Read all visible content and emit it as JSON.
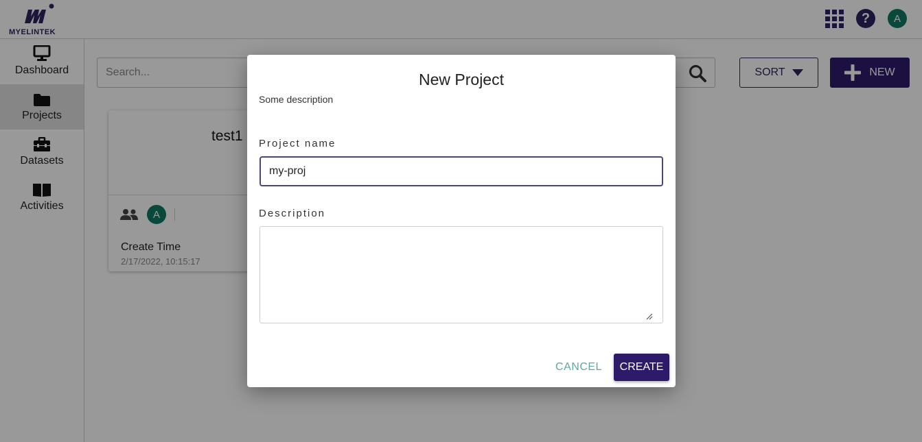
{
  "header": {
    "logo_text": "MYELINTEK",
    "avatar_initial": "A"
  },
  "sidebar": {
    "items": [
      {
        "label": "Dashboard",
        "icon": "monitor-icon"
      },
      {
        "label": "Projects",
        "icon": "folder-icon"
      },
      {
        "label": "Datasets",
        "icon": "toolbox-icon"
      },
      {
        "label": "Activities",
        "icon": "book-icon"
      }
    ]
  },
  "toolbar": {
    "search_placeholder": "Search...",
    "sort_label": "SORT",
    "new_label": "NEW"
  },
  "project_card": {
    "title": "test1",
    "avatar_initial": "A",
    "create_time_label": "Create Time",
    "create_time_value": "2/17/2022, 10:15:17"
  },
  "dialog": {
    "title": "New Project",
    "description": "Some description",
    "project_name_label": "Project name",
    "project_name_value": "my-proj",
    "description_label": "Description",
    "description_value": "",
    "cancel_label": "CANCEL",
    "create_label": "CREATE"
  },
  "colors": {
    "brand": "#2d1b69",
    "avatar": "#0f7a63",
    "cancel_text": "#5fa6a6"
  }
}
